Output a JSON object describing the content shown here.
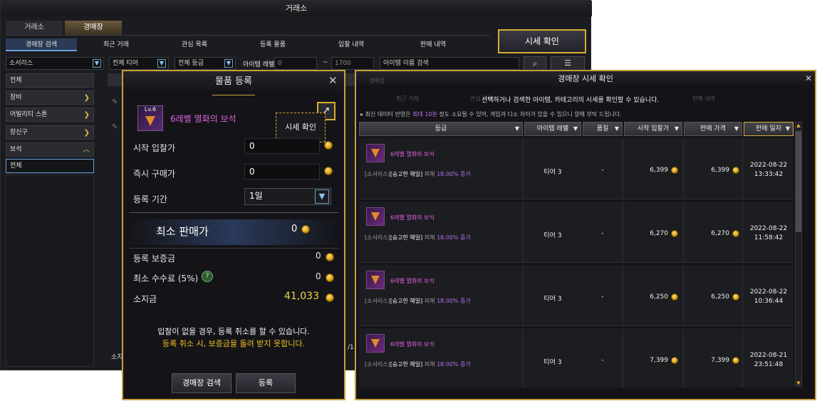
{
  "main": {
    "title": "거래소",
    "tabs": [
      "거래소",
      "경매장"
    ],
    "subtabs": [
      "경매장 검색",
      "최근 거래",
      "관심 목록",
      "등록 물품",
      "입찰 내역",
      "판매 내역"
    ],
    "price_check_button": "시세 확인",
    "filter": {
      "category": "소서리스",
      "tier": "전체 티어",
      "grade": "전체 등급",
      "item_level_label": "아이템 레벨",
      "level_min": "0",
      "level_max": "1700",
      "tilde": "~",
      "item_name_placeholder": "아이템 이름 검색"
    },
    "categories": [
      "전체",
      "장비",
      "어빌리티 스톤",
      "장신구",
      "보석",
      "전체"
    ],
    "hidden_fragments": {
      "f1": "장",
      "f2": "티어 3",
      "f3": "티어 3",
      "f4": "소지",
      "f5": "/1"
    }
  },
  "register": {
    "title": "물품 등록",
    "item_level": "Lv.6",
    "item_name": "6레벨 멸화의 보석",
    "price_check_tooltip": "시세 확인",
    "start_bid_label": "시작 입찰가",
    "start_bid_value": "0",
    "buyout_label": "즉시 구매가",
    "buyout_value": "0",
    "period_label": "등록 기간",
    "period_value": "1일",
    "min_price_label": "최소 판매가",
    "min_price_value": "0",
    "deposit_label": "등록 보증금",
    "deposit_value": "0",
    "fee_label": "최소 수수료 (5%)",
    "fee_value": "0",
    "holding_label": "소지금",
    "holding_value": "41,033",
    "notice1": "입찰이 없을 경우, 등록 취소를 할 수 있습니다.",
    "notice2": "등록 취소 시, 보증금을 돌려 받지 못합니다.",
    "search_button": "경매장 검색",
    "register_button": "등록"
  },
  "price_window": {
    "title": "경매장 시세 확인",
    "behind_tabs": [
      "경매장",
      "최근 거래",
      "관심 목록",
      "판매 내역"
    ],
    "description": "선택하거나 검색한 아이템, 카테고리의 시세를 확인할 수 있습니다.",
    "update_note_prefix": "최신 데이터 반영은 ",
    "update_note_highlight": "최대 10분",
    "update_note_suffix": " 정도 소요될 수 있어, 게임과 다소 차이가 있을 수 있으니 양해 부탁 드립니다.",
    "columns": [
      "등급",
      "아이템 레벨",
      "품질",
      "시작 입찰가",
      "판매 가격",
      "판매 일자"
    ],
    "rows": [
      {
        "name": "6레벨 멸화의 보석",
        "effect_class": "[소서리스]",
        "effect_skill": "[숭고한 해일]",
        "effect_text": " 피해 ",
        "effect_value": "18.00% 증가",
        "tier": "티어 3",
        "quality": "-",
        "start_bid": "6,399",
        "sale_price": "6,399",
        "date": "2022-08-22",
        "time": "13:33:42"
      },
      {
        "name": "6레벨 멸화의 보석",
        "effect_class": "[소서리스]",
        "effect_skill": "[숭고한 해일]",
        "effect_text": " 피해 ",
        "effect_value": "18.00% 증가",
        "tier": "티어 3",
        "quality": "-",
        "start_bid": "6,270",
        "sale_price": "6,270",
        "date": "2022-08-22",
        "time": "11:58:42"
      },
      {
        "name": "6레벨 멸화의 보석",
        "effect_class": "[소서리스]",
        "effect_skill": "[숭고한 해일]",
        "effect_text": " 피해 ",
        "effect_value": "18.00% 증가",
        "tier": "티어 3",
        "quality": "-",
        "start_bid": "6,250",
        "sale_price": "6,250",
        "date": "2022-08-22",
        "time": "10:36:44"
      },
      {
        "name": "6레벨 멸화의 보석",
        "effect_class": "[소서리스]",
        "effect_skill": "[숭고한 해일]",
        "effect_text": " 피해 ",
        "effect_value": "18.00% 증가",
        "tier": "티어 3",
        "quality": "-",
        "start_bid": "7,399",
        "sale_price": "7,399",
        "date": "2022-08-21",
        "time": "23:51:48"
      }
    ]
  }
}
